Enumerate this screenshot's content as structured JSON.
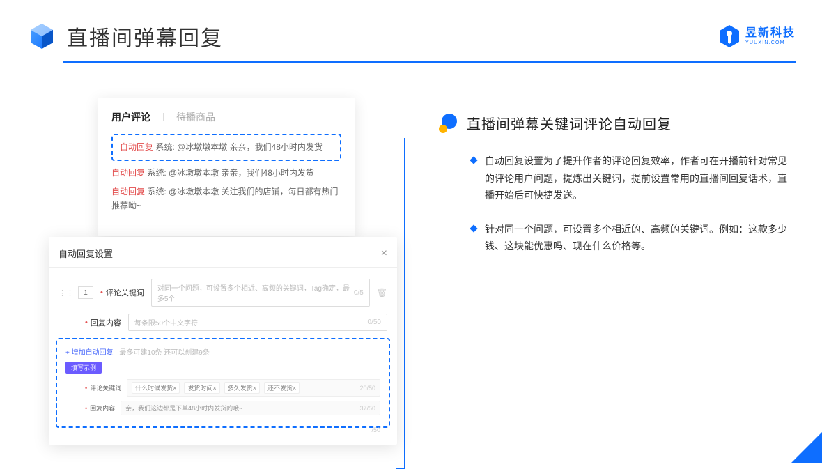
{
  "header": {
    "title": "直播间弹幕回复"
  },
  "logo": {
    "cn": "昱新科技",
    "en": "YUUXIN.COM"
  },
  "comments": {
    "tab_active": "用户评论",
    "tab_inactive": "待播商品",
    "line1_pre": "自动回复",
    "line1_rest": "系统: @冰墩墩本墩 亲亲，我们48小时内发货",
    "line2_pre": "自动回复",
    "line2_rest": "系统: @冰墩墩本墩 亲亲，我们48小时内发货",
    "line3_pre": "自动回复",
    "line3_rest": "系统: @冰墩墩本墩 关注我们的店铺，每日都有热门推荐呦~"
  },
  "settings": {
    "title": "自动回复设置",
    "num": "1",
    "kw_label": "评论关键词",
    "kw_placeholder": "对同一个问题，可设置多个相近、高频的关键词，Tag确定，最多5个",
    "kw_count": "0/5",
    "content_label": "回复内容",
    "content_placeholder": "每条限50个中文字符",
    "content_count": "0/50",
    "add_text": "+ 增加自动回复",
    "add_hint": "最多可建10条 还可以创建9条",
    "badge": "填写示例",
    "ex_kw_label": "评论关键词",
    "ex_kw_tags": [
      "什么时候发货×",
      "发货时间×",
      "多久发货×",
      "还不发货×"
    ],
    "ex_kw_count": "20/50",
    "ex_ct_label": "回复内容",
    "ex_ct_text": "亲，我们这边都是下单48小时内发货的哦~",
    "ex_ct_count": "37/50",
    "outside": "/50"
  },
  "section": {
    "title": "直播间弹幕关键词评论自动回复",
    "b1": "自动回复设置为了提升作者的评论回复效率，作者可在开播前针对常见的评论用户问题，提炼出关键词，提前设置常用的直播间回复话术，直播开始后可快捷发送。",
    "b2": "针对同一个问题，可设置多个相近的、高频的关键词。例如：这款多少钱、这块能优惠吗、现在什么价格等。"
  }
}
